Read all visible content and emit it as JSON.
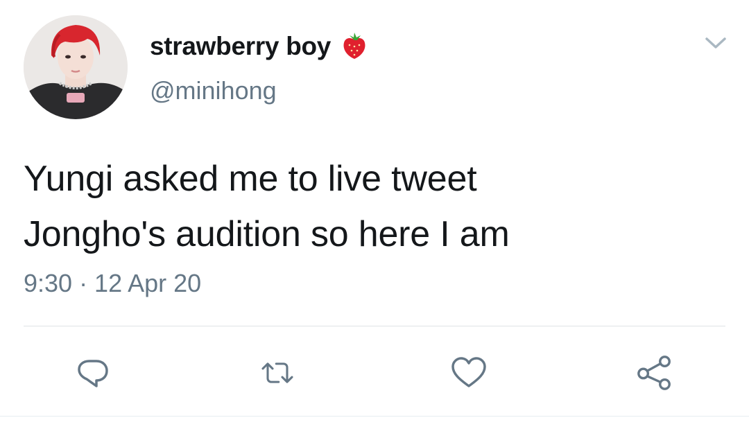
{
  "author": {
    "display_name": "strawberry boy",
    "name_emoji": "strawberry-icon",
    "handle": "@minihong",
    "avatar_alt": "profile photo"
  },
  "tweet": {
    "text_lines": [
      "Yungi asked me to live tweet",
      "Jongho's audition so here I am"
    ],
    "timestamp": "9:30 · 12 Apr 20"
  },
  "actions": [
    {
      "name": "reply",
      "icon": "reply-icon"
    },
    {
      "name": "retweet",
      "icon": "retweet-icon"
    },
    {
      "name": "like",
      "icon": "heart-icon"
    },
    {
      "name": "share",
      "icon": "share-icon"
    }
  ],
  "colors": {
    "text_primary": "#14171a",
    "text_secondary": "#657786",
    "icon": "#657786",
    "divider": "#dfe3e6",
    "strawberry": "#e0202e"
  }
}
